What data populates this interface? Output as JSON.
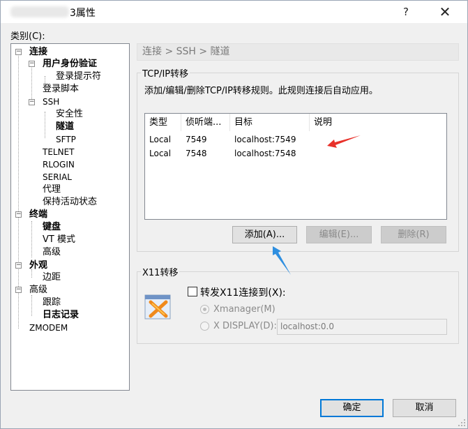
{
  "window": {
    "title_suffix": "3属性",
    "help_glyph": "?",
    "close_glyph": "✕"
  },
  "category_label": "类别(C):",
  "tree": [
    {
      "label": "连接",
      "bold": true,
      "toggle": "−"
    },
    {
      "label": "用户身份验证",
      "bold": true,
      "toggle": "−"
    },
    {
      "label": "登录提示符"
    },
    {
      "label": "登录脚本"
    },
    {
      "label": "SSH",
      "toggle": "−"
    },
    {
      "label": "安全性"
    },
    {
      "label": "隧道",
      "bold": true
    },
    {
      "label": "SFTP"
    },
    {
      "label": "TELNET"
    },
    {
      "label": "RLOGIN"
    },
    {
      "label": "SERIAL"
    },
    {
      "label": "代理"
    },
    {
      "label": "保持活动状态"
    },
    {
      "label": "终端",
      "bold": true,
      "toggle": "−"
    },
    {
      "label": "键盘",
      "bold": true
    },
    {
      "label": "VT 模式"
    },
    {
      "label": "高级"
    },
    {
      "label": "外观",
      "bold": true,
      "toggle": "−"
    },
    {
      "label": "边距"
    },
    {
      "label": "高级",
      "toggle": "−"
    },
    {
      "label": "跟踪"
    },
    {
      "label": "日志记录",
      "bold": true
    },
    {
      "label": "ZMODEM"
    }
  ],
  "breadcrumb": "连接 > SSH > 隧道",
  "tcpip": {
    "group_title": "TCP/IP转移",
    "description": "添加/编辑/删除TCP/IP转移规则。此规则连接后自动应用。",
    "columns": [
      "类型",
      "侦听端...",
      "目标",
      "说明"
    ],
    "rows": [
      {
        "type": "Local",
        "port": "7549",
        "target": "localhost:7549",
        "desc": ""
      },
      {
        "type": "Local",
        "port": "7548",
        "target": "localhost:7548",
        "desc": ""
      }
    ],
    "add_label": "添加(A)...",
    "edit_label": "编辑(E)...",
    "delete_label": "删除(R)"
  },
  "x11": {
    "group_title": "X11转移",
    "forward_label": "转发X11连接到(X):",
    "forward_checked": false,
    "xmanager_label": "Xmanager(M)",
    "xdisplay_label": "X DISPLAY(D):",
    "xdisplay_value": "localhost:0.0",
    "selected": "Xmanager"
  },
  "footer": {
    "ok_label": "确定",
    "cancel_label": "取消"
  },
  "colors": {
    "accent": "#0078d7",
    "annotation_red": "#e8312a",
    "annotation_blue": "#2f8fe0"
  }
}
